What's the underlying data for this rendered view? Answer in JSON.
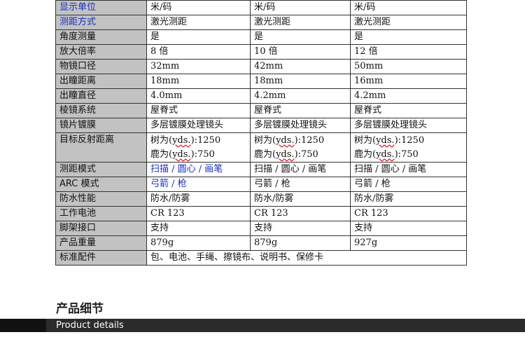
{
  "spec_rows": [
    {
      "label": "显示单位",
      "label_color": "#1a2fbf",
      "cells": [
        "米/码",
        "米/码",
        "米/码"
      ]
    },
    {
      "label": "测距方式",
      "label_color": "#1a2fbf",
      "cells": [
        "激光测距",
        "激光测距",
        "激光测距"
      ]
    },
    {
      "label": "角度测量",
      "cells": [
        "是",
        "是",
        "是"
      ]
    },
    {
      "label": "放大倍率",
      "cells": [
        "8 倍",
        "10 倍",
        "12 倍"
      ]
    },
    {
      "label": "物镜口径",
      "cells": [
        "32mm",
        "42mm",
        "50mm"
      ]
    },
    {
      "label": "出瞳距离",
      "cells": [
        "18mm",
        "18mm",
        "16mm"
      ]
    },
    {
      "label": "出瞳直径",
      "cells": [
        "4.0mm",
        "4.2mm",
        "4.2mm"
      ]
    },
    {
      "label": "棱镜系统",
      "cells": [
        "屋脊式",
        "屋脊式",
        "屋脊式"
      ]
    },
    {
      "label": "镜片镀膜",
      "cells": [
        "多层镀膜处理镜头",
        "多层镀膜处理镜头",
        "多层镀膜处理镜头"
      ]
    },
    {
      "label": "目标反射距离",
      "cells": [
        {
          "tree_prefix": "树为(",
          "unit": "yds.",
          "tree_value": "):1250",
          "deer_prefix": "鹿为(",
          "deer_value": "):750"
        },
        {
          "tree_prefix": "树为(",
          "unit": "yds.",
          "tree_value": "):1250",
          "deer_prefix": "鹿为(",
          "deer_value": "):750"
        },
        {
          "tree_prefix": "树为(",
          "unit": "yds.",
          "tree_value": "):1250",
          "deer_prefix": "鹿为(",
          "deer_value": "):750"
        }
      ]
    },
    {
      "label": "测距模式",
      "cells": [
        "扫描 / 圆心 / 画笔",
        "扫描 / 圆心 / 画笔",
        "扫描 / 圆心 / 画笔"
      ],
      "first_cell_color": "#1a2fbf"
    },
    {
      "label": "ARC 模式",
      "cells": [
        "弓箭 / 枪",
        "弓箭 / 枪",
        "弓箭 / 枪"
      ],
      "first_cell_color": "#1a2fbf"
    },
    {
      "label": "防水性能",
      "cells": [
        "防水/防雾",
        "防水/防雾",
        "防水/防雾"
      ]
    },
    {
      "label": "工作电池",
      "cells": [
        "CR 123",
        "CR 123",
        "CR 123"
      ]
    },
    {
      "label": "脚架接口",
      "cells": [
        "支持",
        "支持",
        "支持"
      ]
    },
    {
      "label": "产品重量",
      "cells": [
        "879g",
        "879g",
        "927g"
      ]
    },
    {
      "label": "标准配件",
      "merged": "包、电池、手绳、擦镜布、说明书、保修卡"
    }
  ],
  "section": {
    "title": "产品细节",
    "bar_text": "Product details"
  }
}
